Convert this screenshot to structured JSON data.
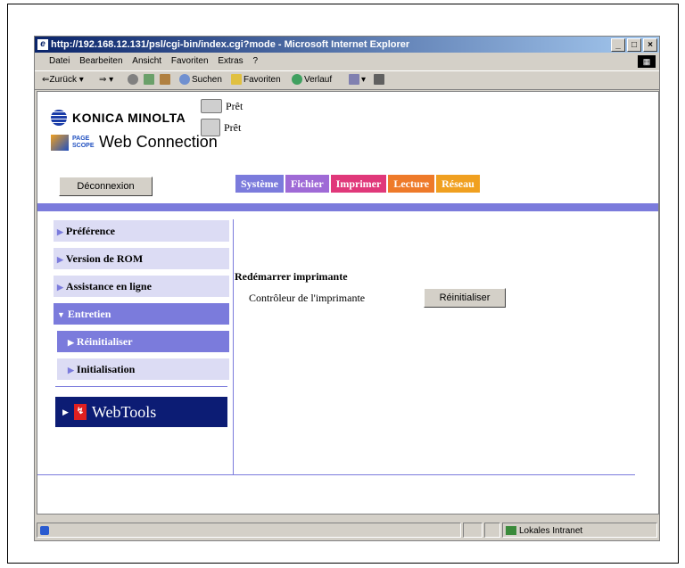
{
  "window": {
    "title": "http://192.168.12.131/psl/cgi-bin/index.cgi?mode - Microsoft Internet Explorer",
    "controls": [
      "_",
      "□",
      "×"
    ]
  },
  "menubar": {
    "items": [
      "Datei",
      "Bearbeiten",
      "Ansicht",
      "Favoriten",
      "Extras",
      "?"
    ]
  },
  "toolbar": {
    "back": "⇐Zurück",
    "search": "Suchen",
    "favorites": "Favoriten",
    "history": "Verlauf"
  },
  "header": {
    "brand": "KONICA MINOLTA",
    "product_small": "PAGE SCOPE",
    "product": "Web Connection",
    "status_1": "Prêt",
    "status_2": "Prêt",
    "logout_label": "Déconnexion"
  },
  "tabs": [
    {
      "label": "Système",
      "color": "#7b7bdc"
    },
    {
      "label": "Fichier",
      "color": "#9f6ad6"
    },
    {
      "label": "Imprimer",
      "color": "#e0387a"
    },
    {
      "label": "Lecture",
      "color": "#ee7a2a"
    },
    {
      "label": "Réseau",
      "color": "#f0a020"
    }
  ],
  "sidebar": {
    "items": [
      {
        "label": "Préférence"
      },
      {
        "label": "Version de ROM"
      },
      {
        "label": "Assistance en ligne"
      },
      {
        "label": "Entretien"
      },
      {
        "label": "Réinitialiser"
      },
      {
        "label": "Initialisation"
      }
    ],
    "webtools_label": "WebTools"
  },
  "main": {
    "title": "Redémarrer imprimante",
    "controller_label": "Contrôleur de l'imprimante",
    "reset_button": "Réinitialiser"
  },
  "statusbar": {
    "zone": "Lokales Intranet"
  }
}
